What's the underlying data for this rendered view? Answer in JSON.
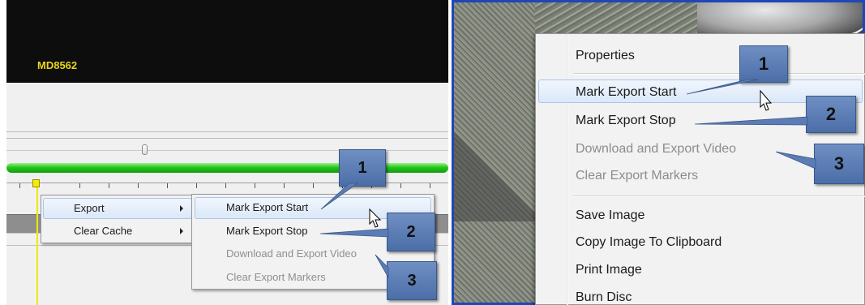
{
  "left": {
    "camera_label": "MD8562",
    "progress_fraction": 1.0,
    "menu_main": {
      "items": [
        "Export",
        "Clear Cache"
      ]
    },
    "menu_export": {
      "items": [
        {
          "label": "Mark Export Start",
          "enabled": true
        },
        {
          "label": "Mark Export Stop",
          "enabled": true
        },
        {
          "label": "Download and Export Video",
          "enabled": false
        },
        {
          "label": "Clear Export Markers",
          "enabled": false
        }
      ]
    },
    "callouts": [
      "1",
      "2",
      "3"
    ]
  },
  "right": {
    "menu": {
      "items": [
        {
          "label": "Properties",
          "enabled": true
        },
        {
          "label": "Mark Export Start",
          "enabled": true
        },
        {
          "label": "Mark Export Stop",
          "enabled": true
        },
        {
          "label": "Download and Export Video",
          "enabled": false
        },
        {
          "label": "Clear Export Markers",
          "enabled": false
        },
        {
          "label": "Save Image",
          "enabled": true
        },
        {
          "label": "Copy Image To Clipboard",
          "enabled": true
        },
        {
          "label": "Print Image",
          "enabled": true
        },
        {
          "label": "Burn Disc",
          "enabled": true
        }
      ]
    },
    "callouts": [
      "1",
      "2",
      "3"
    ]
  },
  "colors": {
    "callout_fill": "#5b7cb5",
    "progress_green": "#22c81a",
    "frame_blue": "#1e47b7",
    "camera_label": "#e8d619"
  },
  "icons": [
    "cursor-arrow-icon",
    "submenu-arrow-icon",
    "slider-thumb-icon",
    "timeline-marker-icon"
  ]
}
